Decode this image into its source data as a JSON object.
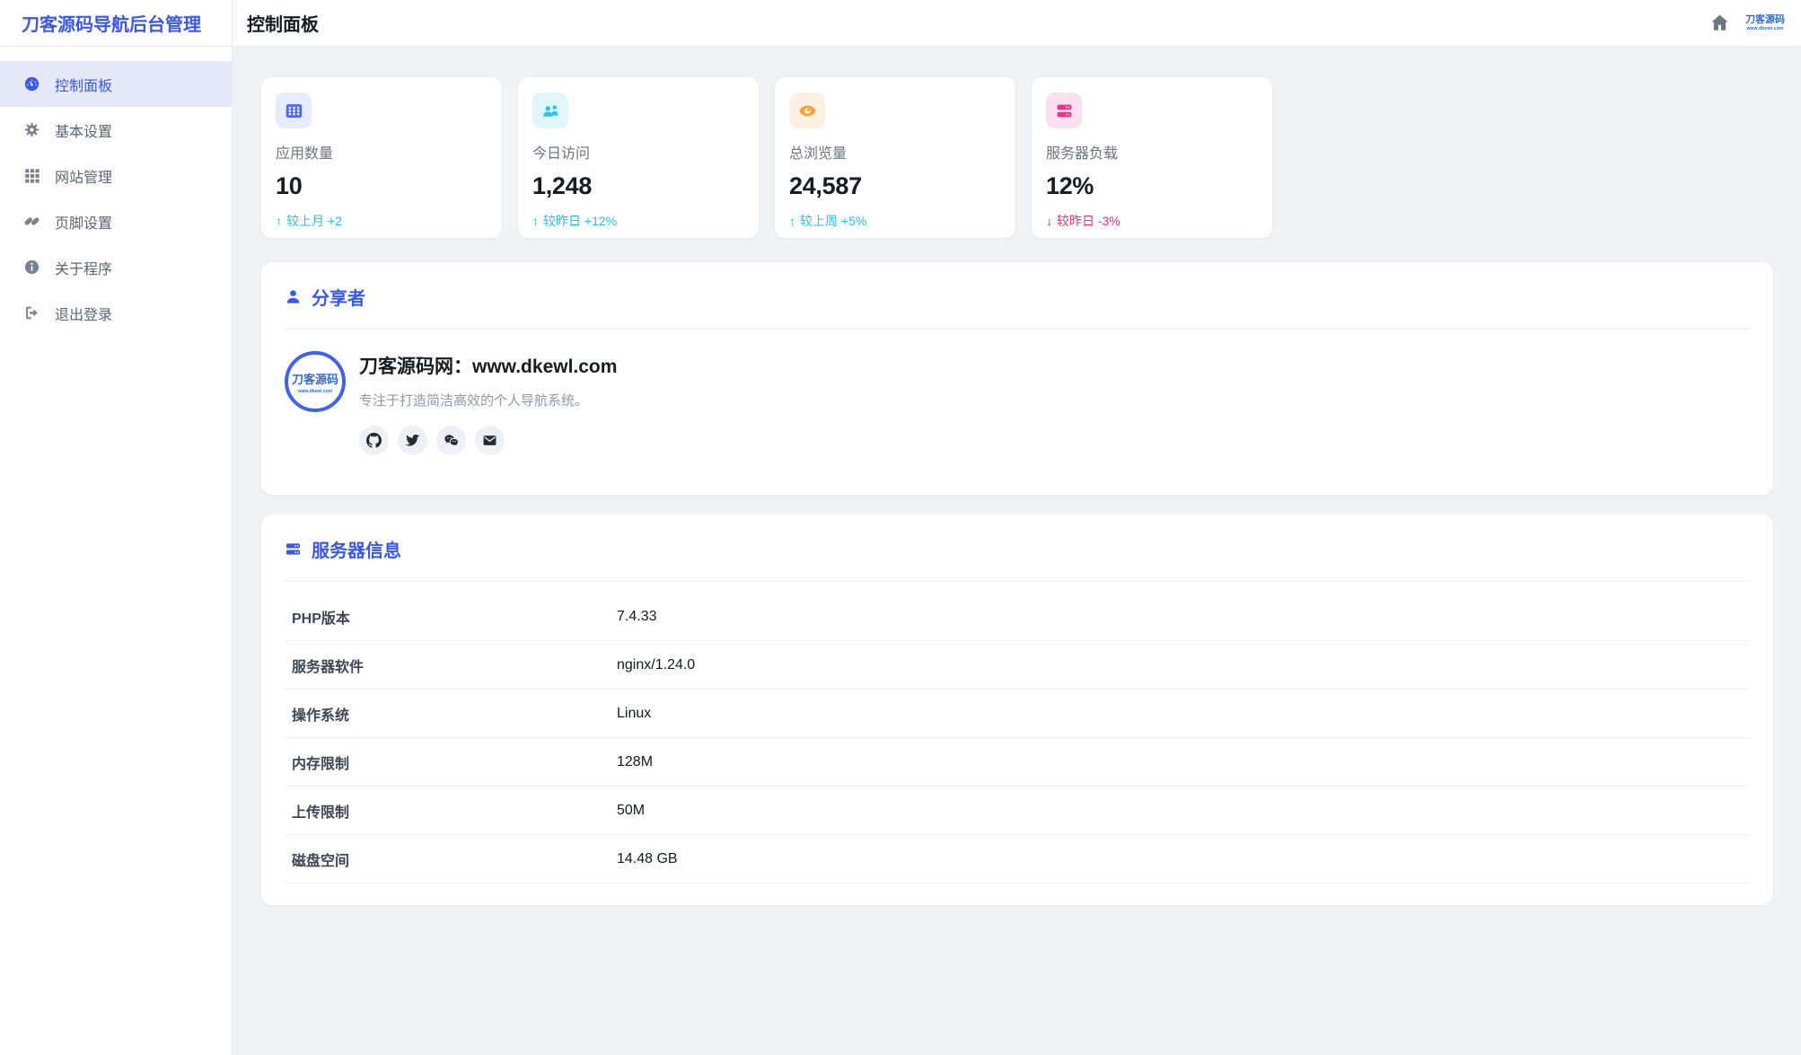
{
  "app": {
    "title": "刀客源码导航后台管理"
  },
  "topbar": {
    "title": "控制面板",
    "logo_text": "刀客源码",
    "logo_sub": "www.dkewl.com"
  },
  "sidebar": {
    "items": [
      {
        "label": "控制面板",
        "icon": "gauge-icon",
        "active": true
      },
      {
        "label": "基本设置",
        "icon": "gear-icon",
        "active": false
      },
      {
        "label": "网站管理",
        "icon": "grid-icon",
        "active": false
      },
      {
        "label": "页脚设置",
        "icon": "link-icon",
        "active": false
      },
      {
        "label": "关于程序",
        "icon": "info-icon",
        "active": false
      },
      {
        "label": "退出登录",
        "icon": "logout-icon",
        "active": false
      }
    ]
  },
  "stats": [
    {
      "label": "应用数量",
      "value": "10",
      "arrow": "↑",
      "trend": "较上月 +2",
      "icon": "grid-icon",
      "icon_color": "#4a67f0",
      "icon_bg": "#e7ebfc",
      "trend_color": "#26c1e8"
    },
    {
      "label": "今日访问",
      "value": "1,248",
      "arrow": "↑",
      "trend": "较昨日 +12%",
      "icon": "users-icon",
      "icon_color": "#2ac3ea",
      "icon_bg": "#e1f6fc",
      "trend_color": "#26c1e8"
    },
    {
      "label": "总浏览量",
      "value": "24,587",
      "arrow": "↑",
      "trend": "较上周 +5%",
      "icon": "eye-icon",
      "icon_color": "#f5a233",
      "icon_bg": "#fdf2e1",
      "trend_color": "#26c1e8"
    },
    {
      "label": "服务器负载",
      "value": "12%",
      "arrow": "↓",
      "trend": "较昨日 -3%",
      "icon": "server-icon",
      "icon_color": "#ef2f86",
      "icon_bg": "#fce0ef",
      "trend_color": "#ee2f7d"
    }
  ],
  "sharer": {
    "header": "分享者",
    "avatar_line1": "刀客源码",
    "avatar_line2": "www.dkewl.com",
    "name": "刀客源码网：www.dkewl.com",
    "desc": "专注于打造简洁高效的个人导航系统。",
    "socials": [
      "github",
      "twitter",
      "wechat",
      "email"
    ]
  },
  "server": {
    "header": "服务器信息",
    "rows": [
      {
        "label": "PHP版本",
        "value": "7.4.33"
      },
      {
        "label": "服务器软件",
        "value": "nginx/1.24.0"
      },
      {
        "label": "操作系统",
        "value": "Linux"
      },
      {
        "label": "内存限制",
        "value": "128M"
      },
      {
        "label": "上传限制",
        "value": "50M"
      },
      {
        "label": "磁盘空间",
        "value": "14.48 GB"
      }
    ]
  },
  "colors": {
    "accent_blue": "#3a57e8",
    "trend_up": "#26c1e8",
    "trend_down": "#ee2f7d",
    "sidebar_active_bg": "#e4e8f9",
    "page_bg": "#f0f2f5"
  }
}
